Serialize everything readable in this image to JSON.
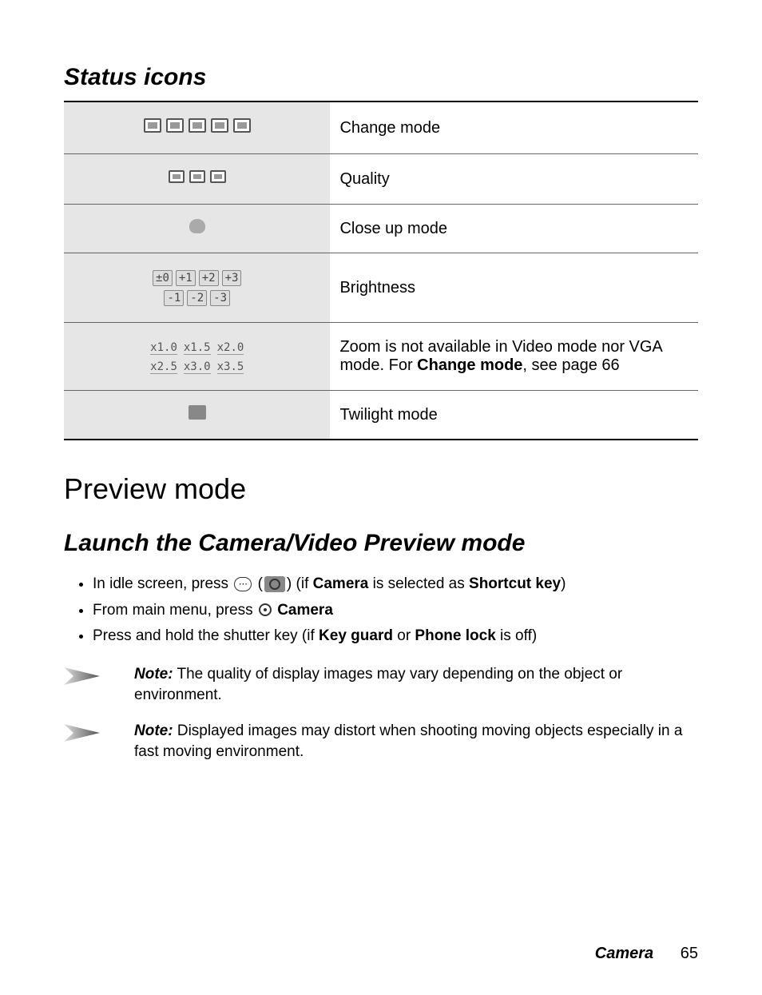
{
  "headings": {
    "status_icons": "Status icons",
    "preview_mode": "Preview mode",
    "launch": "Launch the Camera/Video Preview mode"
  },
  "table": {
    "rows": [
      {
        "icon_set": "mode-icons",
        "desc_parts": [
          {
            "t": "Change mode"
          }
        ]
      },
      {
        "icon_set": "quality-icons",
        "desc_parts": [
          {
            "t": "Quality"
          }
        ]
      },
      {
        "icon_set": "closeup-icon",
        "desc_parts": [
          {
            "t": "Close up mode"
          }
        ]
      },
      {
        "icon_set": "brightness-icons",
        "desc_parts": [
          {
            "t": "Brightness"
          }
        ]
      },
      {
        "icon_set": "zoom-icons",
        "desc_parts": [
          {
            "t": "Zoom is not available in Video mode nor VGA mode. For "
          },
          {
            "t": "Change mode",
            "b": true
          },
          {
            "t": ", see page 66"
          }
        ]
      },
      {
        "icon_set": "twilight-icon",
        "desc_parts": [
          {
            "t": "Twilight mode"
          }
        ]
      }
    ]
  },
  "brightness_labels": [
    "±0",
    "+1",
    "+2",
    "+3",
    "-1",
    "-2",
    "-3"
  ],
  "zoom_labels": [
    "x1.0",
    "x1.5",
    "x2.0",
    "x2.5",
    "x3.0",
    "x3.5"
  ],
  "bullets": [
    {
      "parts": [
        {
          "t": "In idle screen, press "
        },
        {
          "icon": "softkey"
        },
        {
          "t": " ("
        },
        {
          "icon": "camera"
        },
        {
          "t": ") (if "
        },
        {
          "t": "Camera",
          "b": true
        },
        {
          "t": " is selected as "
        },
        {
          "t": "Shortcut key",
          "b": true
        },
        {
          "t": ")"
        }
      ]
    },
    {
      "parts": [
        {
          "t": "From main menu, press "
        },
        {
          "icon": "nav"
        },
        {
          "t": " "
        },
        {
          "t": "Camera",
          "b": true
        }
      ]
    },
    {
      "parts": [
        {
          "t": "Press and hold the shutter key (if "
        },
        {
          "t": "Key guard",
          "b": true
        },
        {
          "t": " or "
        },
        {
          "t": "Phone lock",
          "b": true
        },
        {
          "t": " is off)"
        }
      ]
    }
  ],
  "notes": [
    {
      "label": "Note:",
      "text": " The quality of display images may vary depending on the object or environment."
    },
    {
      "label": "Note:",
      "text": " Displayed images may distort when shooting moving objects especially in a fast moving environment."
    }
  ],
  "footer": {
    "chapter": "Camera",
    "page": "65"
  }
}
